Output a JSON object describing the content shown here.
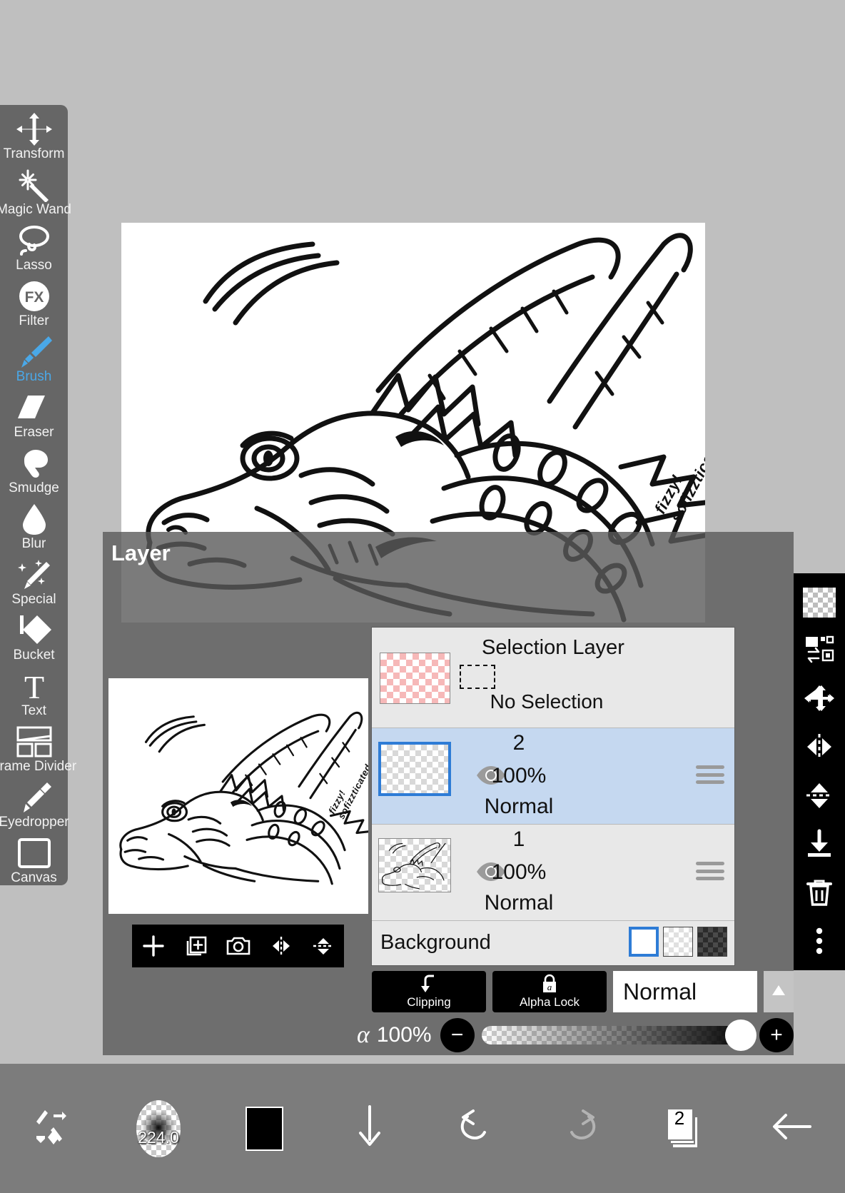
{
  "app": {
    "canvas_background": "#bfbfbf",
    "panel_background": "#5a5a5a",
    "accent": "#2e7cd6",
    "active_tool_color": "#4aa8e8"
  },
  "toolbar_left": {
    "items": [
      {
        "label": "Transform",
        "icon": "move-arrows-icon",
        "active": false
      },
      {
        "label": "Magic Wand",
        "icon": "magic-wand-icon",
        "active": false
      },
      {
        "label": "Lasso",
        "icon": "lasso-icon",
        "active": false
      },
      {
        "label": "Filter",
        "icon": "fx-circle-icon",
        "active": false
      },
      {
        "label": "Brush",
        "icon": "brush-icon",
        "active": true
      },
      {
        "label": "Eraser",
        "icon": "eraser-icon",
        "active": false
      },
      {
        "label": "Smudge",
        "icon": "smudge-finger-icon",
        "active": false
      },
      {
        "label": "Blur",
        "icon": "droplet-icon",
        "active": false
      },
      {
        "label": "Special",
        "icon": "sparkle-pencil-icon",
        "active": false
      },
      {
        "label": "Bucket",
        "icon": "paint-bucket-icon",
        "active": false
      },
      {
        "label": "Text",
        "icon": "text-t-icon",
        "active": false
      },
      {
        "label": "Frame Divider",
        "icon": "frame-divider-icon",
        "active": false
      },
      {
        "label": "Eyedropper",
        "icon": "eyedropper-icon",
        "active": false
      },
      {
        "label": "Canvas",
        "icon": "canvas-square-icon",
        "active": false
      }
    ]
  },
  "layer_panel": {
    "title": "Layer",
    "preview_toolbar": [
      {
        "icon": "plus-icon",
        "name": "add-layer-button"
      },
      {
        "icon": "add-boxed-icon",
        "name": "duplicate-layer-button"
      },
      {
        "icon": "camera-icon",
        "name": "camera-import-button"
      },
      {
        "icon": "flip-horizontal-icon",
        "name": "flip-horizontal-button"
      },
      {
        "icon": "flip-vertical-icon",
        "name": "flip-vertical-button"
      }
    ],
    "selection_layer": {
      "title": "Selection Layer",
      "status": "No Selection"
    },
    "layers": [
      {
        "name": "2",
        "opacity": "100%",
        "blend": "Normal",
        "selected": true,
        "visible": true,
        "thumb": "empty"
      },
      {
        "name": "1",
        "opacity": "100%",
        "blend": "Normal",
        "selected": false,
        "visible": true,
        "thumb": "dragon-lineart"
      }
    ],
    "background": {
      "label": "Background",
      "swatches": [
        {
          "type": "solid-white",
          "selected": true
        },
        {
          "type": "light-checker",
          "selected": false
        },
        {
          "type": "dark-checker",
          "selected": false
        }
      ]
    },
    "clipping": {
      "label": "Clipping",
      "icon": "clipping-arrow-icon"
    },
    "alpha_lock": {
      "label": "Alpha Lock",
      "icon": "alpha-lock-icon"
    },
    "blend_mode": {
      "value": "Normal",
      "arrow_icon": "triangle-up-icon"
    },
    "opacity": {
      "symbol": "α",
      "value": "100%",
      "minus_label": "−",
      "plus_label": "+",
      "percent": 100
    }
  },
  "toolbar_right": {
    "items": [
      {
        "icon": "checker-swatch-icon",
        "name": "transparency-button"
      },
      {
        "icon": "layer-transfer-icon",
        "name": "layer-transfer-button"
      },
      {
        "icon": "move-arrows-icon",
        "name": "move-layer-button"
      },
      {
        "icon": "flip-horizontal-icon",
        "name": "flip-horizontal-button"
      },
      {
        "icon": "flip-vertical-icon",
        "name": "flip-vertical-button"
      },
      {
        "icon": "download-icon",
        "name": "merge-down-button"
      },
      {
        "icon": "trash-icon",
        "name": "delete-layer-button"
      },
      {
        "icon": "more-vertical-icon",
        "name": "more-options-button"
      }
    ]
  },
  "toolbar_bottom": {
    "items": [
      {
        "icon": "swap-tools-icon",
        "name": "tool-swap-button",
        "label": ""
      },
      {
        "icon": "brush-preview-icon",
        "name": "brush-size-button",
        "label": "224.0"
      },
      {
        "icon": "color-chip-icon",
        "name": "color-swatch-button",
        "label": ""
      },
      {
        "icon": "arrow-down-icon",
        "name": "hide-ui-button",
        "label": ""
      },
      {
        "icon": "undo-icon",
        "name": "undo-button",
        "label": ""
      },
      {
        "icon": "redo-icon",
        "name": "redo-button",
        "label": "",
        "disabled": true
      },
      {
        "icon": "layers-stack-icon",
        "name": "layers-button",
        "label": "2"
      },
      {
        "icon": "arrow-left-icon",
        "name": "back-button",
        "label": ""
      }
    ]
  },
  "artwork": {
    "signature_line1": "fizzy!",
    "signature_line2": "sofizzticated_",
    "description": "Black and white dragon head line art facing left with long horns and spiked frill"
  }
}
